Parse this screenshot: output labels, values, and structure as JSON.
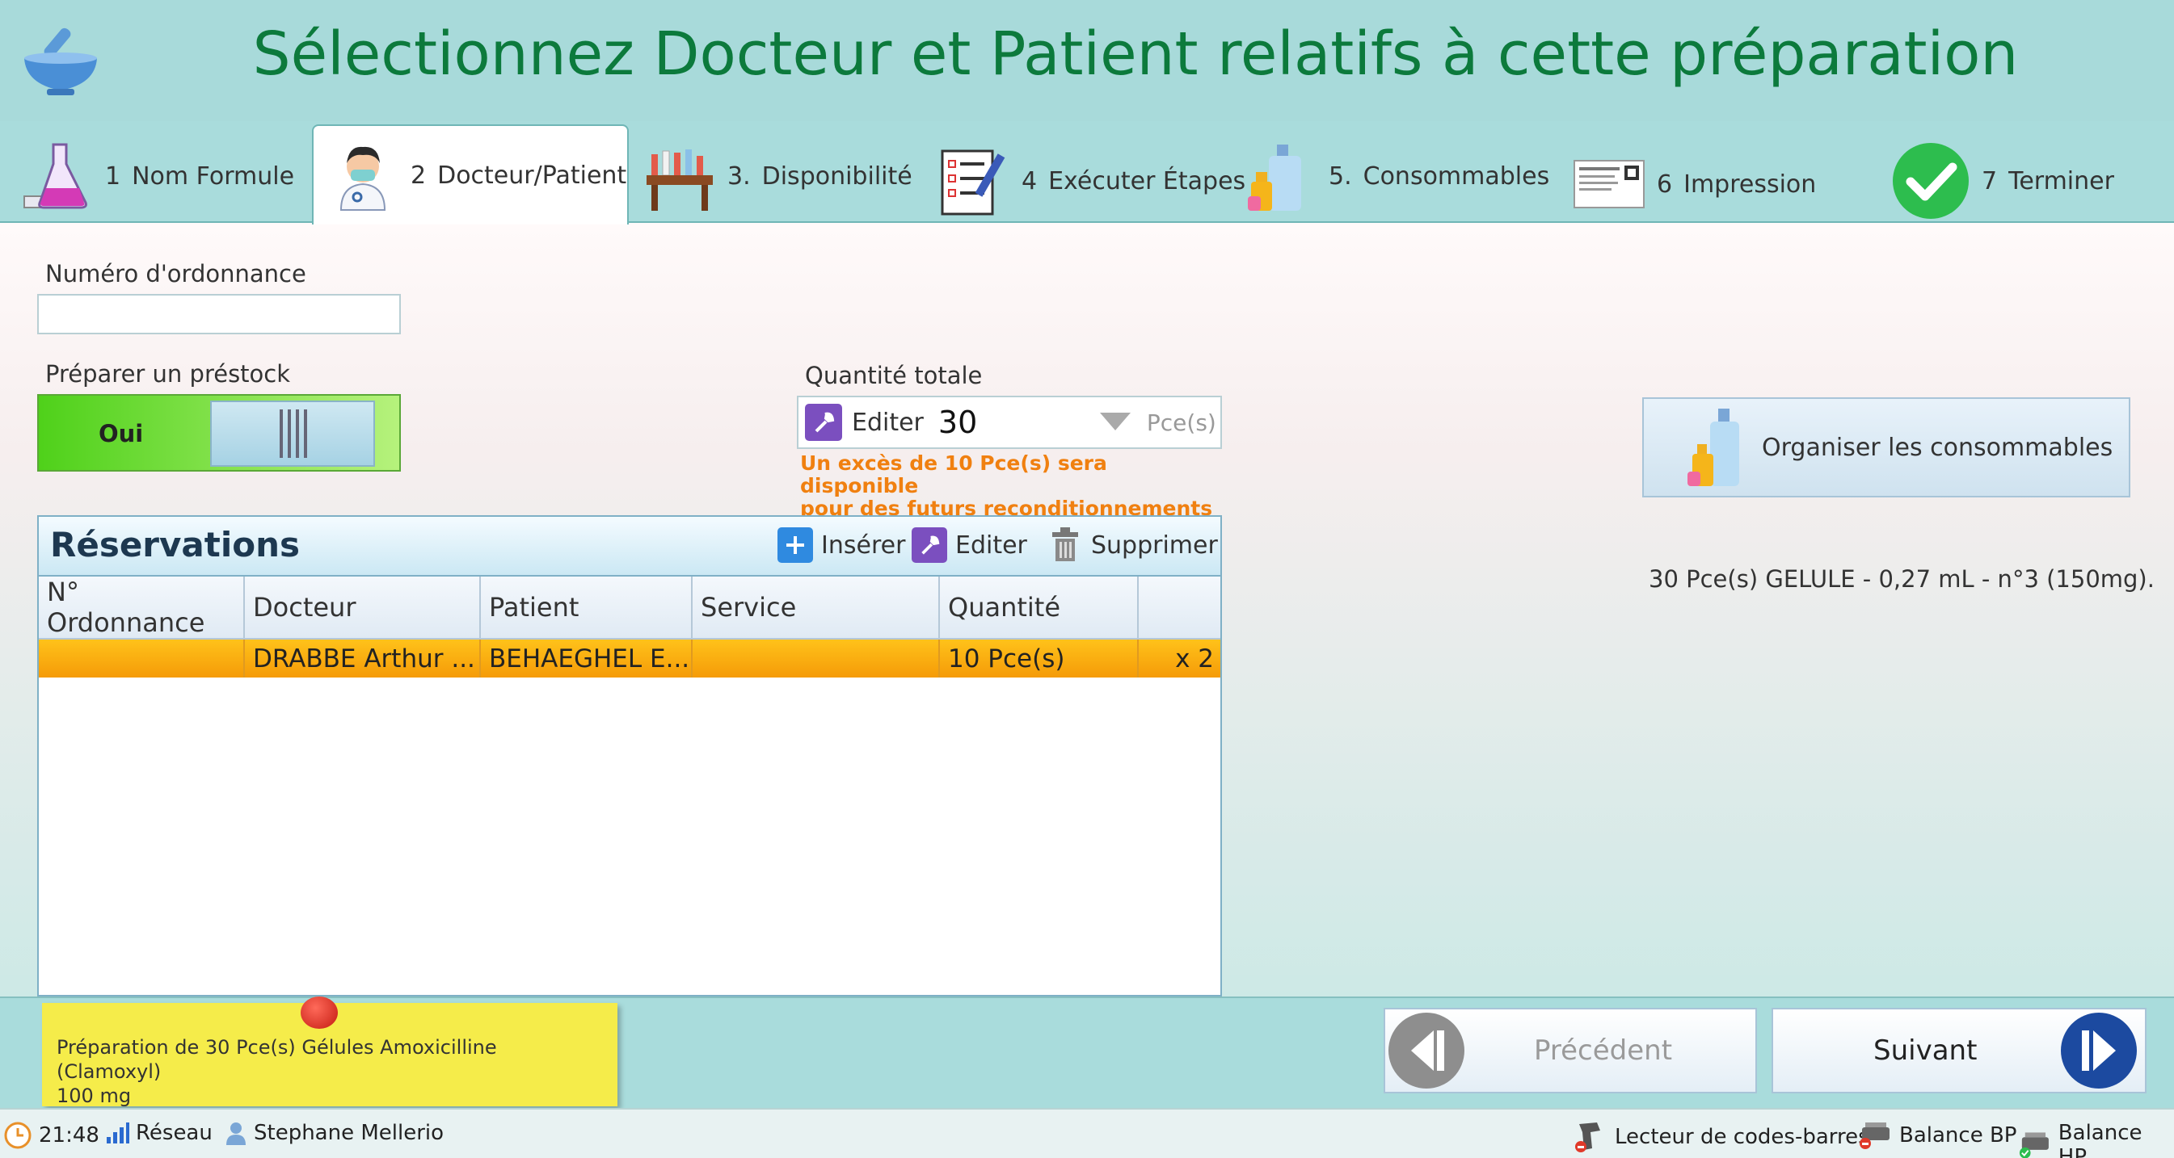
{
  "header": {
    "title": "Sélectionnez Docteur et Patient relatifs à cette préparation"
  },
  "tabs": [
    {
      "num": "1",
      "label": "Nom Formule",
      "icon": "flask-icon"
    },
    {
      "num": "2",
      "label": "Docteur/Patient",
      "icon": "doctor-icon",
      "active": true
    },
    {
      "num": "3.",
      "label": "Disponibilité",
      "icon": "table-icon"
    },
    {
      "num": "4",
      "label": "Exécuter Étapes",
      "icon": "checklist-icon"
    },
    {
      "num": "5.",
      "label": "Consommables",
      "icon": "bottles-icon"
    },
    {
      "num": "6",
      "label": "Impression",
      "icon": "label-icon"
    },
    {
      "num": "7",
      "label": "Terminer",
      "icon": "check-icon"
    }
  ],
  "form": {
    "ordonnance_label": "Numéro  d'ordonnance",
    "ordonnance_value": "",
    "prestock_label": "Préparer un préstock",
    "prestock_state": "Oui",
    "quantite_label": "Quantité totale",
    "quantite_edit": "Editer",
    "quantite_value": "30",
    "quantite_unit": "Pce(s)",
    "warning_line1": "Un excès de 10 Pce(s) sera disponible",
    "warning_line2": "pour des futurs reconditionnements"
  },
  "consommables": {
    "button_label": "Organiser les consommables",
    "summary": "30 Pce(s) GELULE - 0,27 mL - n°3 (150mg)."
  },
  "reservations": {
    "title": "Réservations",
    "insert": "Insérer",
    "edit": "Editer",
    "delete": "Supprimer",
    "columns": [
      "N° Ordonnance",
      "Docteur",
      "Patient",
      "Service",
      "Quantité",
      ""
    ],
    "rows": [
      {
        "ordonnance": "",
        "docteur": "DRABBE Arthur ...",
        "patient": "BEHAEGHEL E...",
        "service": "",
        "quantite": "10 Pce(s)",
        "mult": "x 2"
      }
    ]
  },
  "footer": {
    "note_line1": "Préparation de 30 Pce(s) Gélules Amoxicilline (Clamoxyl)",
    "note_line2": "100 mg",
    "prev": "Précédent",
    "next": "Suivant"
  },
  "status": {
    "time": "21:48",
    "network": "Réseau",
    "user": "Stephane Mellerio",
    "barcode": "Lecteur de codes-barres",
    "balance_bp": "Balance BP",
    "balance_hp": "Balance HP"
  },
  "colors": {
    "title": "#0c7a3c",
    "accent_selected_row": "#f7a70c",
    "warning": "#f08010",
    "toggle_on": "#4fd11a"
  }
}
